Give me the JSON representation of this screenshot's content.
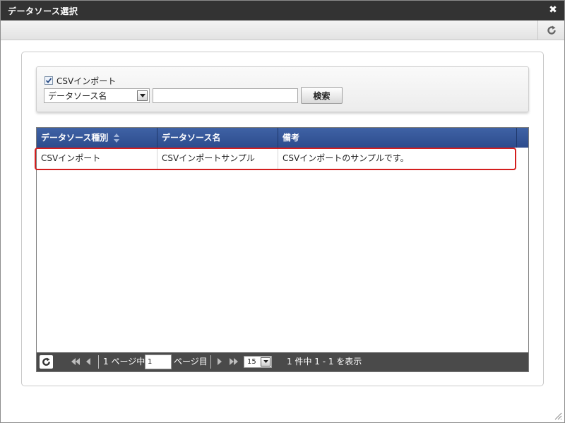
{
  "dialog": {
    "title": "データソース選択",
    "close_label": "✖"
  },
  "search": {
    "checkbox_label": "CSVインポート",
    "checkbox_checked": true,
    "field_select": "データソース名",
    "keyword_value": "",
    "button_label": "検索"
  },
  "table": {
    "columns": [
      "データソース種別",
      "データソース名",
      "備考"
    ],
    "rows": [
      {
        "type": "CSVインポート",
        "name": "CSVインポートサンプル",
        "note": "CSVインポートのサンプルです。"
      }
    ]
  },
  "pager": {
    "page_prefix": "1 ページ中",
    "page_value": "1",
    "page_suffix": "ページ目",
    "page_size": "15",
    "summary": "1 件中 1 - 1 を表示"
  },
  "colors": {
    "titlebar": "#333333",
    "header": "#34559a",
    "highlight": "#d41e1e",
    "pager": "#4a4a4a"
  }
}
